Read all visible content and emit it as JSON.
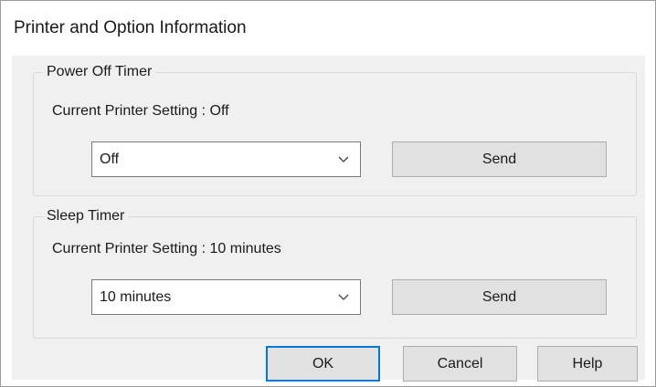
{
  "window": {
    "title": "Printer and Option Information"
  },
  "power_off_timer": {
    "group_label": "Power Off Timer",
    "current_setting_text": "Current Printer Setting : Off",
    "selected_value": "Off",
    "send_label": "Send"
  },
  "sleep_timer": {
    "group_label": "Sleep Timer",
    "current_setting_text": "Current Printer Setting : 10 minutes",
    "selected_value": "10 minutes",
    "send_label": "Send"
  },
  "buttons": {
    "ok_label": "OK",
    "cancel_label": "Cancel",
    "help_label": "Help"
  },
  "colors": {
    "dialog_background": "#f0f0f0",
    "button_face": "#e1e1e1",
    "default_button_border": "#0078d7"
  }
}
